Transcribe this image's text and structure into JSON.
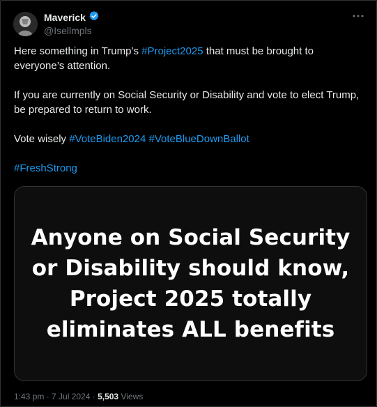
{
  "tweet": {
    "author_name": "Maverick",
    "author_handle": "@Isellmpls",
    "verified": true,
    "more_icon": "ellipsis-icon",
    "paragraphs": [
      [
        {
          "text": "Here something in Trump’s ",
          "hashtag": false
        },
        {
          "text": "#Project2025",
          "hashtag": true
        },
        {
          "text": " that must be brought to everyone’s attention.",
          "hashtag": false
        }
      ],
      [
        {
          "text": "If you are currently on Social Security or Disability and vote to elect Trump, be prepared to return to work.",
          "hashtag": false
        }
      ],
      [
        {
          "text": "Vote wisely ",
          "hashtag": false
        },
        {
          "text": "#VoteBiden2024",
          "hashtag": true
        },
        {
          "text": " ",
          "hashtag": false
        },
        {
          "text": "#VoteBlueDownBallot",
          "hashtag": true
        }
      ],
      [
        {
          "text": "#FreshStrong",
          "hashtag": true
        }
      ]
    ],
    "media_text": "Anyone on Social Security or Disability should know, Project 2025 totally eliminates ALL benefits",
    "timestamp": "1:43 pm · 7 Jul 2024",
    "separator": " · ",
    "views_count": "5,503",
    "views_label": "Views"
  },
  "colors": {
    "background": "#000000",
    "text": "#e7e9ea",
    "secondary": "#71767b",
    "hashtag": "#1d9bf0",
    "verified_badge": "#1d9bf0",
    "border": "#2f3336"
  }
}
